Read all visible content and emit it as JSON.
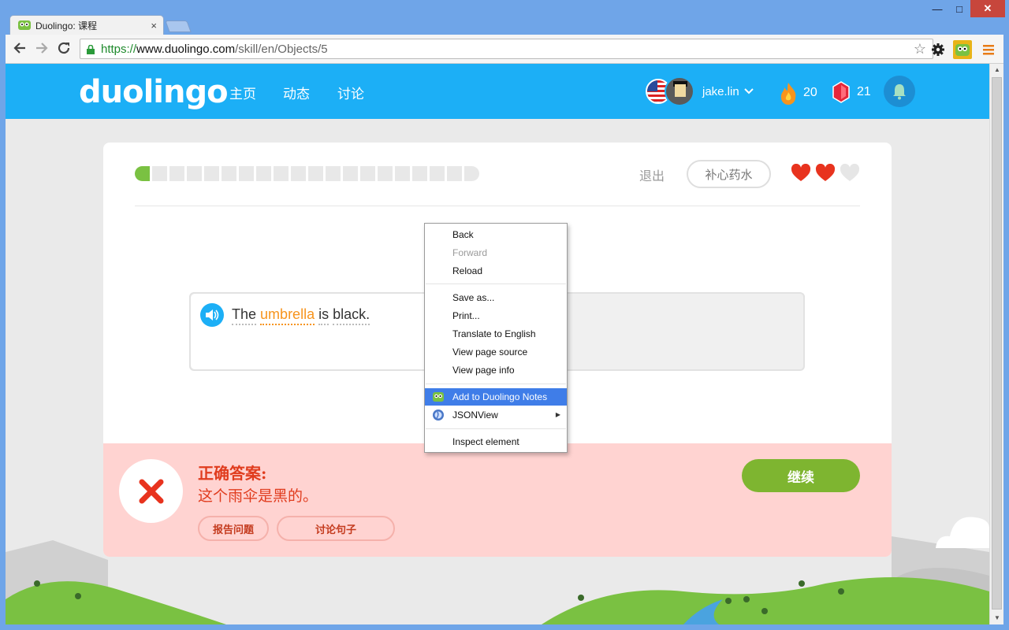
{
  "browser": {
    "tab_title": "Duolingo: 课程",
    "tab_close": "×",
    "url_scheme": "https://",
    "url_host": "www.duolingo.com",
    "url_path": "/skill/en/Objects/5",
    "window_controls": {
      "minimize": "—",
      "maximize": "□",
      "close": "✕"
    }
  },
  "header": {
    "logo": "duolingo",
    "nav": [
      "主页",
      "动态",
      "讨论"
    ],
    "username": "jake.lin",
    "streak": "20",
    "lingots": "21"
  },
  "lesson": {
    "progress_segments": 20,
    "progress_completed": 1,
    "quit_label": "退出",
    "heal_label": "补心药水",
    "hearts_filled": 2,
    "hearts_total": 3,
    "sentence": {
      "w1": "The",
      "w2": "umbrella",
      "w3": "is",
      "w4": "black."
    }
  },
  "feedback": {
    "title": "正确答案:",
    "answer": "这个雨伞是黑的。",
    "report_label": "报告问题",
    "discuss_label": "讨论句子",
    "continue_label": "继续"
  },
  "context_menu": {
    "back": "Back",
    "forward": "Forward",
    "reload": "Reload",
    "save_as": "Save as...",
    "print": "Print...",
    "translate": "Translate to English",
    "view_source": "View page source",
    "page_info": "View page info",
    "add_notes": "Add to Duolingo Notes",
    "jsonview": "JSONView",
    "inspect": "Inspect element"
  },
  "colors": {
    "brand_blue": "#1caff6",
    "correct_green": "#7ac142",
    "error_red": "#e03c1e",
    "feedback_bg": "#ffd3d1",
    "menu_highlight": "#3f7de8"
  }
}
